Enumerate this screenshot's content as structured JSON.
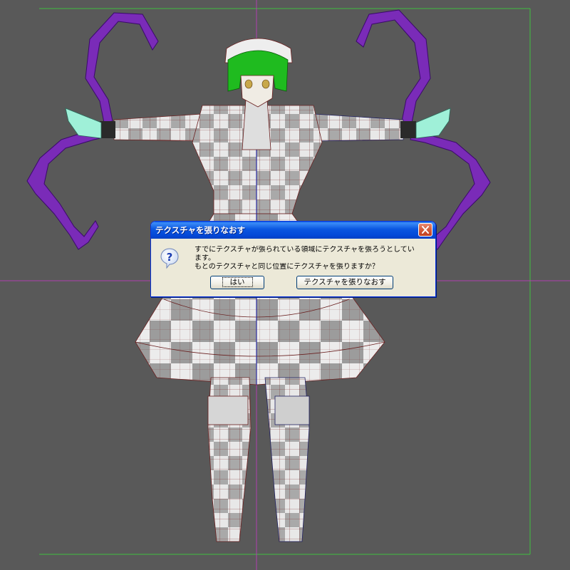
{
  "viewport": {
    "name": "3D model viewport",
    "background_color": "#595959",
    "grid_line_color": "#b040b0",
    "frame_color": "#3fbf3f",
    "model": "maid character with purple tentacle arms, checker texture"
  },
  "dialog": {
    "title": "テクスチャを張りなおす",
    "icon": "question-icon",
    "message_line1": "すでにテクスチャが張られている領域にテクスチャを張ろうとしてい",
    "message_line2": "ます。",
    "message_line3": "もとのテクスチャと同じ位置にテクスチャを張りますか？",
    "yes_label": "はい",
    "retexture_label": "テクスチャを張りなおす",
    "close_icon": "close-icon",
    "title_color": "#0a56e0"
  }
}
